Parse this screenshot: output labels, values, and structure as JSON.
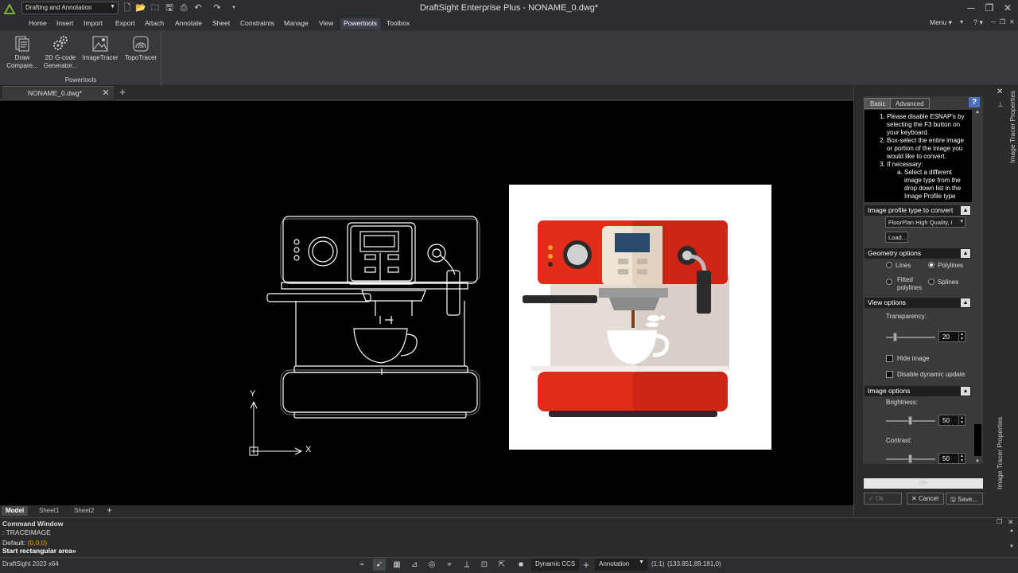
{
  "window": {
    "title": "DraftSight Enterprise Plus - NONAME_0.dwg*",
    "workspace": "Drafting and Annotation"
  },
  "menu": {
    "items": [
      "Home",
      "Insert",
      "Import",
      "Export",
      "Attach",
      "Annotate",
      "Sheet",
      "Constraints",
      "Manage",
      "View",
      "Powertools",
      "Toolbox"
    ],
    "active": "Powertools",
    "right_label": "Menu"
  },
  "ribbon": {
    "group_label": "Powertools",
    "buttons": [
      {
        "line1": "Draw",
        "line2": "Compare...",
        "icon": "draw-compare-icon"
      },
      {
        "line1": "2D G-code",
        "line2": "Generator...",
        "icon": "gcode-gear-icon"
      },
      {
        "line1": "ImageTracer",
        "line2": "",
        "icon": "image-tracer-icon"
      },
      {
        "line1": "TopoTracer",
        "line2": "",
        "icon": "topo-tracer-icon"
      }
    ]
  },
  "document_tab": {
    "name": "NONAME_0.dwg*"
  },
  "sheet_tabs": [
    "Model",
    "Sheet1",
    "Sheet2"
  ],
  "ucs": {
    "y_label": "Y",
    "x_label": "X"
  },
  "command_window": {
    "title": "Command Window",
    "line1": ": TRACEIMAGE",
    "line2_prefix": "Default: ",
    "line2_value": "(0,0,0)",
    "line3": "Start rectangular area»"
  },
  "statusbar": {
    "left": "DraftSight 2023 x64",
    "ccs": "Dynamic CCS",
    "annotation": "Annotation",
    "scale": "(1:1)",
    "coords": "(133.851,89.181,0)"
  },
  "panel": {
    "title": "Image Tracer Properties",
    "tabs": [
      "Basic",
      "Advanced"
    ],
    "active_tab": "Basic",
    "instructions": {
      "step1": "Please disable ESNAP's by selecting the F3 button on your keyboard.",
      "step2": "Box-select the entire image or portion of the image you would like to convert.",
      "step3": "If necessary:",
      "step3a": "Select a different image type from the drop down list in the Image Profile type"
    },
    "profile": {
      "header": "Image profile type to convert",
      "value": "FloorPlan High Quality, I",
      "load": "Load..."
    },
    "geometry": {
      "header": "Geometry options",
      "lines": "Lines",
      "polylines": "Polylines",
      "fitted1": "Fitted",
      "fitted2": "polylines",
      "splines": "Splines",
      "selected": "Polylines"
    },
    "view": {
      "header": "View options",
      "transparency_label": "Transparency:",
      "transparency": 20,
      "hide_image": "Hide image",
      "disable_update": "Disable dynamic update"
    },
    "image": {
      "header": "Image options",
      "brightness_label": "Brightness:",
      "brightness": 50,
      "contrast_label": "Contrast:",
      "contrast": 50
    },
    "progress": "0%",
    "buttons": {
      "ok": "Ok",
      "cancel": "Cancel",
      "save": "Save..."
    }
  }
}
